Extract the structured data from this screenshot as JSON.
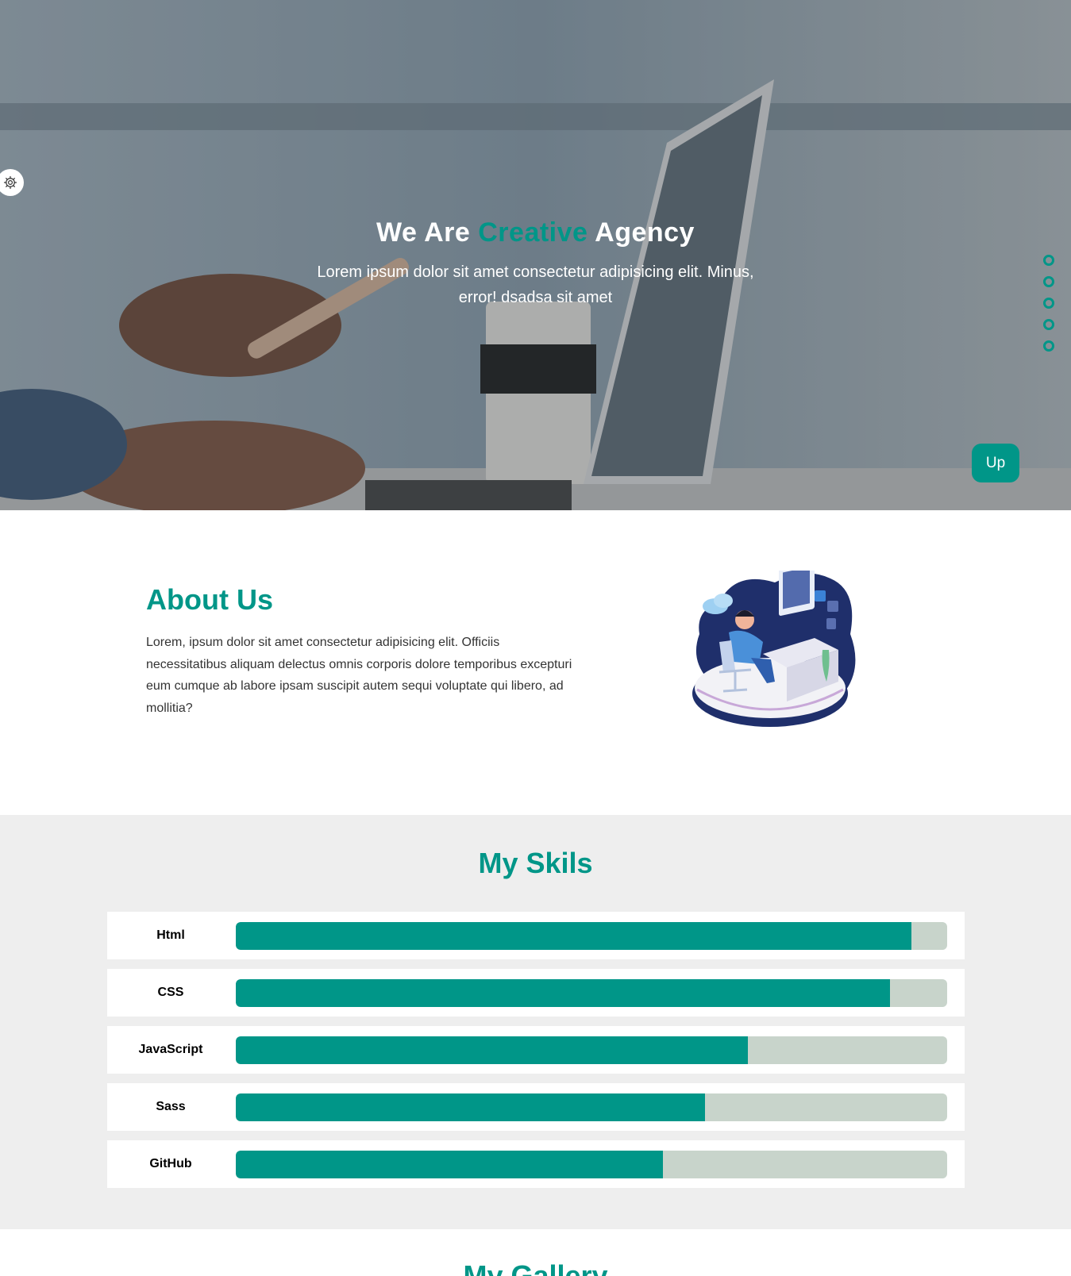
{
  "hero": {
    "title_part1": "We Are ",
    "title_accent": "Creative",
    "title_part2": " Agency",
    "subtitle": "Lorem ipsum dolor sit amet consectetur adipisicing elit. Minus, error! dsadsa sit amet",
    "up_label": "Up",
    "settings_icon": "gear-icon",
    "bullet_count": 5
  },
  "about": {
    "title": "About Us",
    "text": "Lorem, ipsum dolor sit amet consectetur adipisicing elit. Officiis necessitatibus aliquam delectus omnis corporis dolore temporibus excepturi eum cumque ab labore ipsam suscipit autem sequi voluptate qui libero, ad mollitia?"
  },
  "skills": {
    "title": "My Skils",
    "items": [
      {
        "name": "Html",
        "percent": 95
      },
      {
        "name": "CSS",
        "percent": 92
      },
      {
        "name": "JavaScript",
        "percent": 72
      },
      {
        "name": "Sass",
        "percent": 66
      },
      {
        "name": "GitHub",
        "percent": 60
      }
    ]
  },
  "gallery": {
    "title": "My Gallery"
  },
  "colors": {
    "accent": "#009688",
    "track": "#c8d4cb",
    "section_bg": "#eeeeee"
  }
}
